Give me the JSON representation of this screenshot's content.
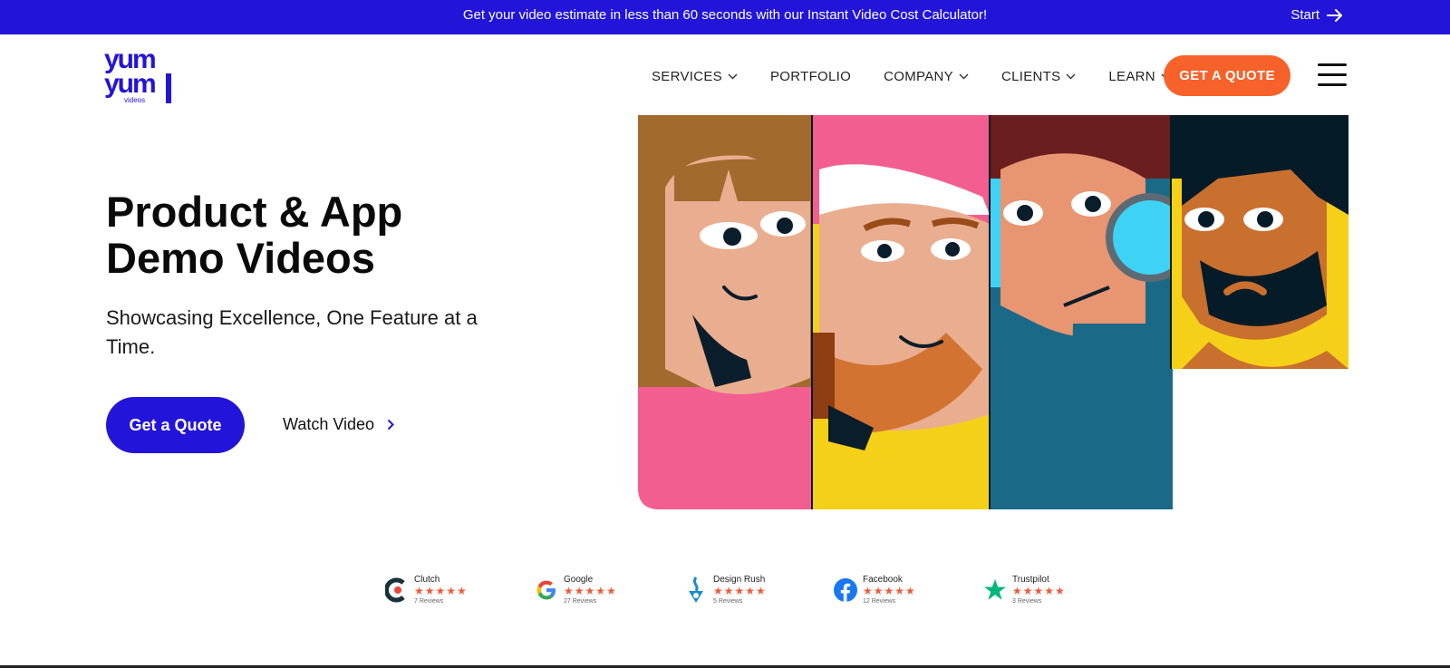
{
  "announcement": {
    "text": "Get your video estimate in less than 60 seconds with our Instant Video Cost Calculator!",
    "start_label": "Start",
    "background_color": "#2314d9"
  },
  "logo": {
    "brand_lines": [
      "yum",
      "yum"
    ],
    "sub": "videos",
    "color": "#2314d9"
  },
  "nav": {
    "items": [
      {
        "label": "SERVICES",
        "dropdown": true
      },
      {
        "label": "PORTFOLIO",
        "dropdown": false
      },
      {
        "label": "COMPANY",
        "dropdown": true
      },
      {
        "label": "CLIENTS",
        "dropdown": true
      },
      {
        "label": "LEARN",
        "dropdown": true
      }
    ],
    "quote_label": "GET A QUOTE",
    "quote_color": "#f7622a"
  },
  "hero": {
    "title": "Product & App Demo Videos",
    "subtitle": "Showcasing Excellence, One Feature at a Time.",
    "cta_primary": "Get a Quote",
    "cta_secondary": "Watch Video"
  },
  "reviews": [
    {
      "name": "Clutch",
      "count": "7 Reviews",
      "stars": "★★★★★",
      "icon": "clutch-logo-icon"
    },
    {
      "name": "Google",
      "count": "27 Reviews",
      "stars": "★★★★★",
      "icon": "google-logo-icon"
    },
    {
      "name": "Design Rush",
      "count": "5 Reviews",
      "stars": "★★★★★",
      "icon": "designrush-logo-icon"
    },
    {
      "name": "Facebook",
      "count": "12 Reviews",
      "stars": "★★★★★",
      "icon": "facebook-logo-icon"
    },
    {
      "name": "Trustpilot",
      "count": "3 Reviews",
      "stars": "★★★★★",
      "icon": "trustpilot-logo-icon"
    }
  ]
}
